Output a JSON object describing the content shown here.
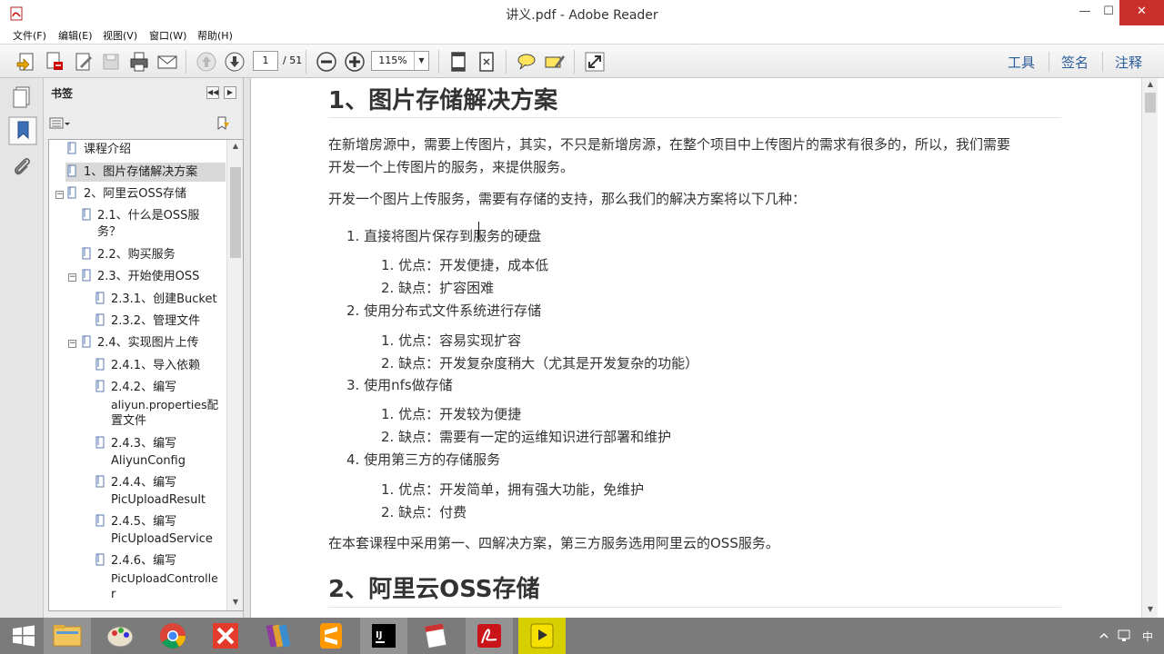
{
  "window": {
    "title": "讲义.pdf - Adobe Reader",
    "minimize": "—",
    "maximize": "☐",
    "close": "✕"
  },
  "menu": [
    "文件(F)",
    "编辑(E)",
    "视图(V)",
    "窗口(W)",
    "帮助(H)"
  ],
  "toolbar": {
    "current_page": "1",
    "total_pages": "/ 51",
    "zoom": "115%",
    "tools_label": "工具",
    "sign_label": "签名",
    "comment_label": "注释"
  },
  "bookmarks": {
    "title": "书签",
    "items": [
      {
        "label": "课程介绍"
      },
      {
        "label": "1、图片存储解决方案"
      },
      {
        "label": "2、阿里云OSS存储"
      },
      {
        "label": "2.1、什么是OSS服",
        "label2": "务？"
      },
      {
        "label": "2.2、购买服务"
      },
      {
        "label": "2.3、开始使用OSS"
      },
      {
        "label": "2.3.1、创建Bucket"
      },
      {
        "label": "2.3.2、管理文件"
      },
      {
        "label": "2.4、实现图片上传"
      },
      {
        "label": "2.4.1、导入依赖"
      },
      {
        "label": "2.4.2、编写",
        "label2": "aliyun.properties配",
        "label3": "置文件"
      },
      {
        "label": "2.4.3、编写",
        "label2": "AliyunConfig"
      },
      {
        "label": "2.4.4、编写",
        "label2": "PicUploadResult"
      },
      {
        "label": "2.4.5、编写",
        "label2": "PicUploadService"
      },
      {
        "label": "2.4.6、编写",
        "label2": "PicUploadControlle",
        "label3": "r"
      }
    ]
  },
  "document": {
    "heading1": "1、图片存储解决方案",
    "para1_line1": "在新增房源中，需要上传图片，其实，不只是新增房源，在整个项目中上传图片的需求有很多的，所以，我们需要",
    "para1_line2": "开发一个上传图片的服务，来提供服务。",
    "para2": "开发一个图片上传服务，需要有存储的支持，那么我们的解决方案将以下几种：",
    "list": [
      {
        "text": "1. 直接将图片保存到服务的硬盘",
        "sub": [
          "1. 优点：开发便捷，成本低",
          "2. 缺点：扩容困难"
        ]
      },
      {
        "text": "2. 使用分布式文件系统进行存储",
        "sub": [
          "1. 优点：容易实现扩容",
          "2. 缺点：开发复杂度稍大（尤其是开发复杂的功能）"
        ]
      },
      {
        "text": "3. 使用nfs做存储",
        "sub": [
          "1. 优点：开发较为便捷",
          "2. 缺点：需要有一定的运维知识进行部署和维护"
        ]
      },
      {
        "text": "4. 使用第三方的存储服务",
        "sub": [
          "1. 优点：开发简单，拥有强大功能，免维护",
          "2. 缺点：付费"
        ]
      }
    ],
    "para3": "在本套课程中采用第一、四解决方案，第三方服务选用阿里云的OSS服务。",
    "heading2": "2、阿里云OSS存储"
  },
  "taskbar": {
    "apps": [
      "start-icon",
      "file-explorer-icon",
      "paint-icon",
      "chrome-icon",
      "xmind-icon",
      "winrar-icon",
      "sublime-icon",
      "intellij-icon",
      "mail-icon",
      "adobe-reader-icon",
      "media-player-icon"
    ],
    "tray_time": "中"
  }
}
